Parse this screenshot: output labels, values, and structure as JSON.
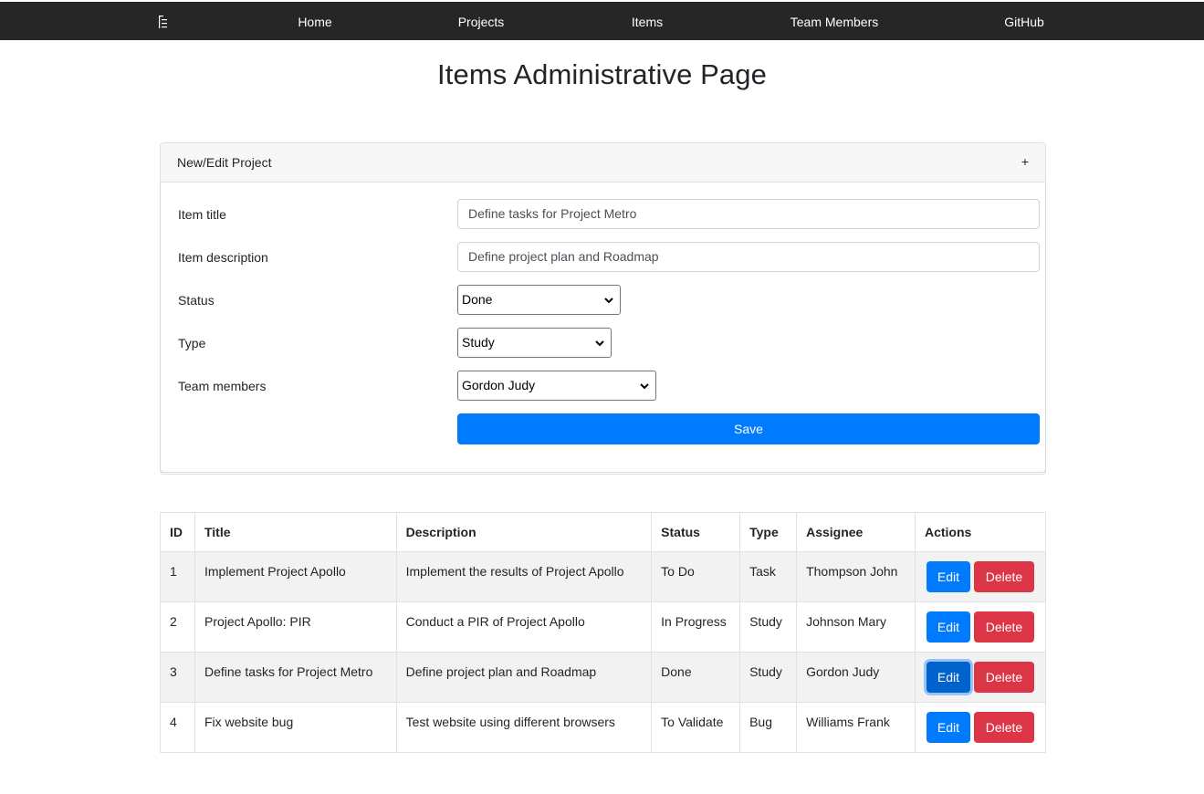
{
  "nav": {
    "links": [
      "Home",
      "Projects",
      "Items",
      "Team Members",
      "GitHub"
    ]
  },
  "page_title": "Items Administrative Page",
  "form": {
    "header": "New/Edit Project",
    "toggle": "+",
    "title_label": "Item title",
    "title_value": "Define tasks for Project Metro",
    "description_label": "Item description",
    "description_value": "Define project plan and Roadmap",
    "status_label": "Status",
    "status_value": "Done",
    "type_label": "Type",
    "type_value": "Study",
    "members_label": "Team members",
    "members_value": "Gordon Judy",
    "save_label": "Save"
  },
  "table": {
    "headers": [
      "ID",
      "Title",
      "Description",
      "Status",
      "Type",
      "Assignee",
      "Actions"
    ],
    "rows": [
      {
        "id": "1",
        "title": "Implement Project Apollo",
        "description": "Implement the results of Project Apollo",
        "status": "To Do",
        "type": "Task",
        "assignee": "Thompson John"
      },
      {
        "id": "2",
        "title": "Project Apollo: PIR",
        "description": "Conduct a PIR of Project Apollo",
        "status": "In Progress",
        "type": "Study",
        "assignee": "Johnson Mary"
      },
      {
        "id": "3",
        "title": "Define tasks for Project Metro",
        "description": "Define project plan and Roadmap",
        "status": "Done",
        "type": "Study",
        "assignee": "Gordon Judy"
      },
      {
        "id": "4",
        "title": "Fix website bug",
        "description": "Test website using different browsers",
        "status": "To Validate",
        "type": "Bug",
        "assignee": "Williams Frank"
      }
    ],
    "edit_label": "Edit",
    "delete_label": "Delete"
  },
  "colors": {
    "navbar": "#262626",
    "primary": "#007bff",
    "danger": "#dc3545"
  }
}
